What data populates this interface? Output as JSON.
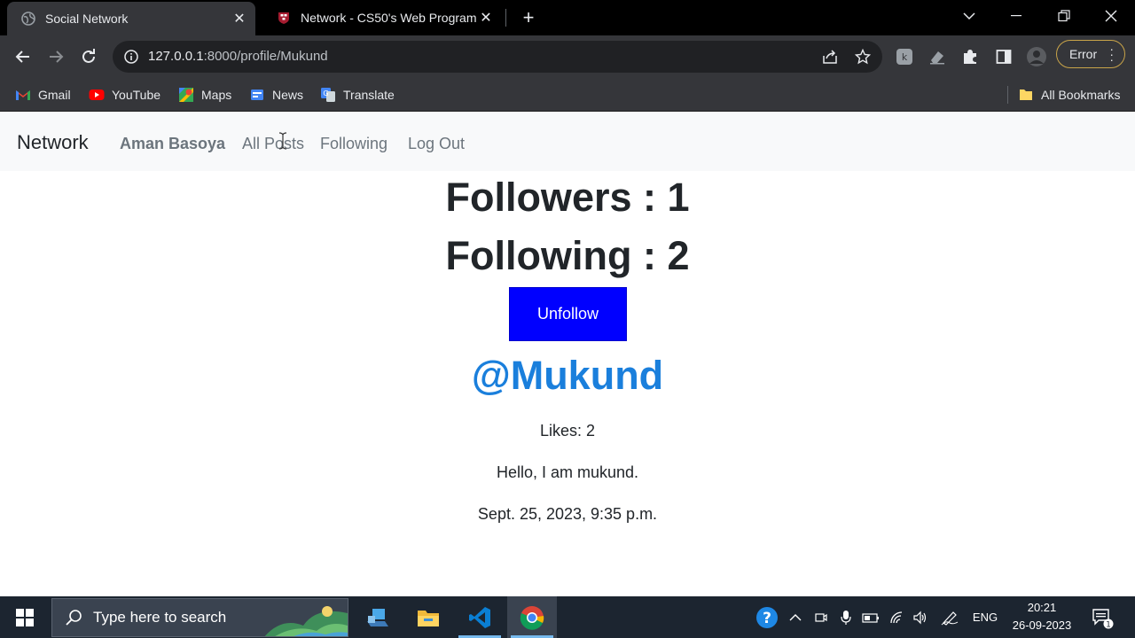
{
  "browser": {
    "tabs": [
      {
        "title": "Social Network",
        "active": true
      },
      {
        "title": "Network - CS50's Web Programm",
        "active": false
      }
    ],
    "address": {
      "host": "127.0.0.1",
      "rest": ":8000/profile/Mukund"
    },
    "error_label": "Error",
    "bookmarks": [
      {
        "label": "Gmail",
        "icon": "gmail-icon"
      },
      {
        "label": "YouTube",
        "icon": "youtube-icon"
      },
      {
        "label": "Maps",
        "icon": "maps-icon"
      },
      {
        "label": "News",
        "icon": "news-icon"
      },
      {
        "label": "Translate",
        "icon": "translate-icon"
      }
    ],
    "all_bookmarks": "All Bookmarks"
  },
  "site": {
    "brand": "Network",
    "nav": {
      "user": "Aman Basoya",
      "all_posts": "All Posts",
      "following": "Following",
      "logout": "Log Out"
    }
  },
  "profile": {
    "followers": "Followers : 1",
    "following": "Following : 2",
    "button": "Unfollow",
    "handle": "@Mukund",
    "post": {
      "likes": "Likes: 2",
      "content": "Hello, I am mukund.",
      "timestamp": "Sept. 25, 2023, 9:35 p.m."
    }
  },
  "taskbar": {
    "search_placeholder": "Type here to search",
    "language": "ENG",
    "time": "20:21",
    "date": "26-09-2023",
    "notifications": "1"
  },
  "colors": {
    "unfollow_button": "#0000ff",
    "handle": "#1a7fdc",
    "navbar_bg": "#f8f9fa"
  }
}
